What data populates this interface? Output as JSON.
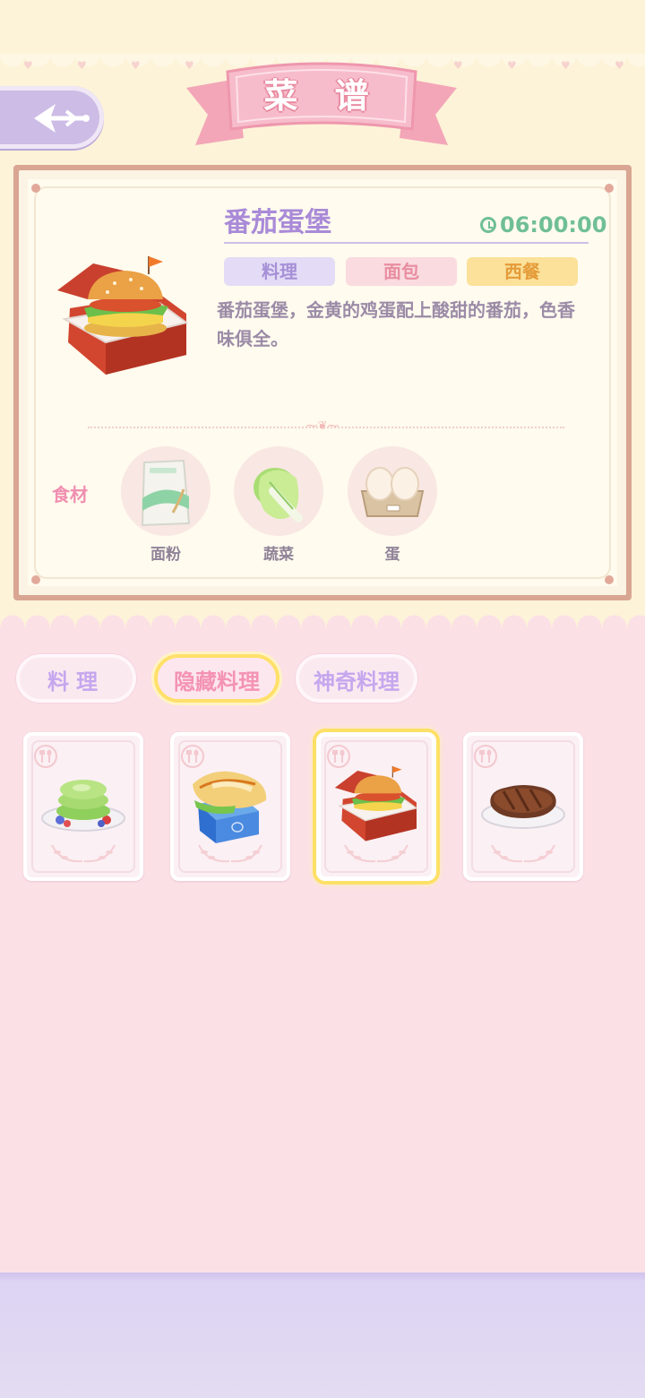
{
  "header": {
    "title": "菜 谱",
    "back_icon": "back-arrow-icon"
  },
  "detail": {
    "name": "番茄蛋堡",
    "timer": "06:00:00",
    "tags": [
      "料理",
      "面包",
      "西餐"
    ],
    "description": "番茄蛋堡，金黄的鸡蛋配上酸甜的番茄，色香味俱全。",
    "ingredients_label": "食材",
    "ingredients": [
      {
        "name": "面粉",
        "icon": "flour-bag-icon"
      },
      {
        "name": "蔬菜",
        "icon": "cabbage-icon"
      },
      {
        "name": "蛋",
        "icon": "egg-carton-icon"
      }
    ]
  },
  "tabs": [
    {
      "label": "料理",
      "active": false
    },
    {
      "label": "隐藏料理",
      "active": true
    },
    {
      "label": "神奇料理",
      "active": false
    }
  ],
  "recipes": [
    {
      "icon": "matcha-pancake-icon",
      "selected": false
    },
    {
      "icon": "boxed-sandwich-icon",
      "selected": false
    },
    {
      "icon": "tomato-egg-burger-icon",
      "selected": true
    },
    {
      "icon": "steak-icon",
      "selected": false
    }
  ],
  "colors": {
    "accent_purple": "#a98ad8",
    "pink": "#f493b3",
    "yellow_highlight": "#ffe06a",
    "green_timer": "#6fbf94"
  }
}
